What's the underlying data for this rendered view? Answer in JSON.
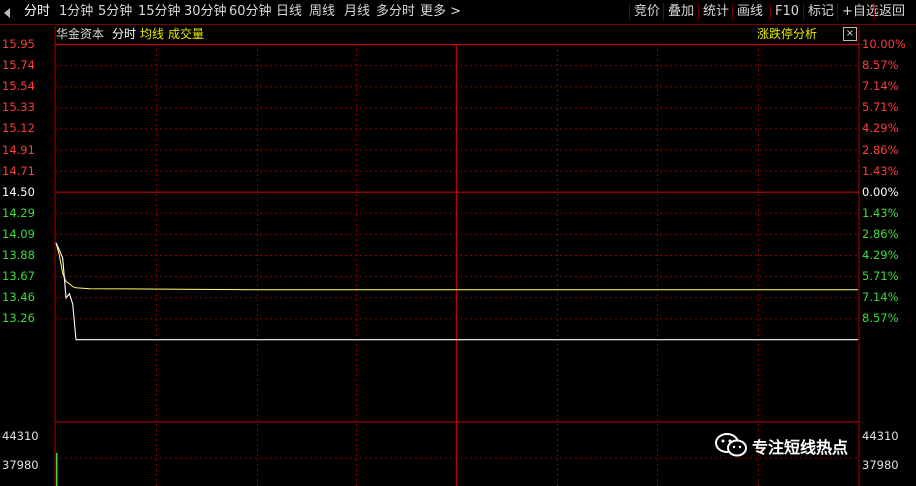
{
  "toolbar": {
    "left_items": [
      {
        "label": "分时",
        "active": true
      },
      {
        "label": "1分钟"
      },
      {
        "label": "5分钟"
      },
      {
        "label": "15分钟"
      },
      {
        "label": "30分钟"
      },
      {
        "label": "60分钟"
      },
      {
        "label": "日线"
      },
      {
        "label": "周线"
      },
      {
        "label": "月线"
      },
      {
        "label": "多分时"
      },
      {
        "label": "更多 >"
      }
    ],
    "right_items": [
      {
        "label": "竞价"
      },
      {
        "label": "叠加"
      },
      {
        "label": "统计"
      },
      {
        "label": "画线"
      },
      {
        "label": "F10"
      },
      {
        "label": "标记"
      },
      {
        "label": "+自选"
      },
      {
        "label": "返回"
      }
    ]
  },
  "header": {
    "stock_name": "华金资本",
    "mode": "分时",
    "avg_label": "均线",
    "volume_label": "成交量",
    "limit_analysis": "涨跌停分析",
    "close_symbol": "×"
  },
  "colors": {
    "up": "#ff3c3c",
    "down": "#3cdc3c",
    "neutral": "#ffffff",
    "grid": "#8b0000",
    "price_line": "#ffffff",
    "avg_line": "#ffff66",
    "header_yellow": "#e8e800"
  },
  "axes": {
    "price_ticks": [
      "15.95",
      "15.74",
      "15.54",
      "15.33",
      "15.12",
      "14.91",
      "14.71",
      "14.50",
      "14.29",
      "14.09",
      "13.88",
      "13.67",
      "13.46",
      "13.26"
    ],
    "pct_ticks": [
      "10.00%",
      "8.57%",
      "7.14%",
      "5.71%",
      "4.29%",
      "2.86%",
      "1.43%",
      "0.00%",
      "1.43%",
      "2.86%",
      "4.29%",
      "5.71%",
      "7.14%",
      "8.57%"
    ],
    "volume_ticks": [
      "44310",
      "37980"
    ]
  },
  "watermark": {
    "text": "专注短线热点",
    "icon": "wechat-icon"
  },
  "chart_data": {
    "type": "line",
    "prev_close": 14.5,
    "ylim": [
      13.26,
      15.95
    ],
    "series": [
      {
        "values": [
          14.0,
          13.93,
          13.85,
          13.46,
          13.5,
          13.4,
          13.05,
          13.05,
          13.05,
          13.05,
          13.05
        ]
      },
      {
        "values": [
          14.0,
          13.88,
          13.7,
          13.62,
          13.6,
          13.57,
          13.56,
          13.55,
          13.54,
          13.54,
          13.54
        ]
      }
    ],
    "x": [
      0,
      1,
      2,
      3,
      4,
      5,
      6,
      10,
      60,
      200,
      240
    ],
    "volume_values": [
      44310
    ]
  }
}
